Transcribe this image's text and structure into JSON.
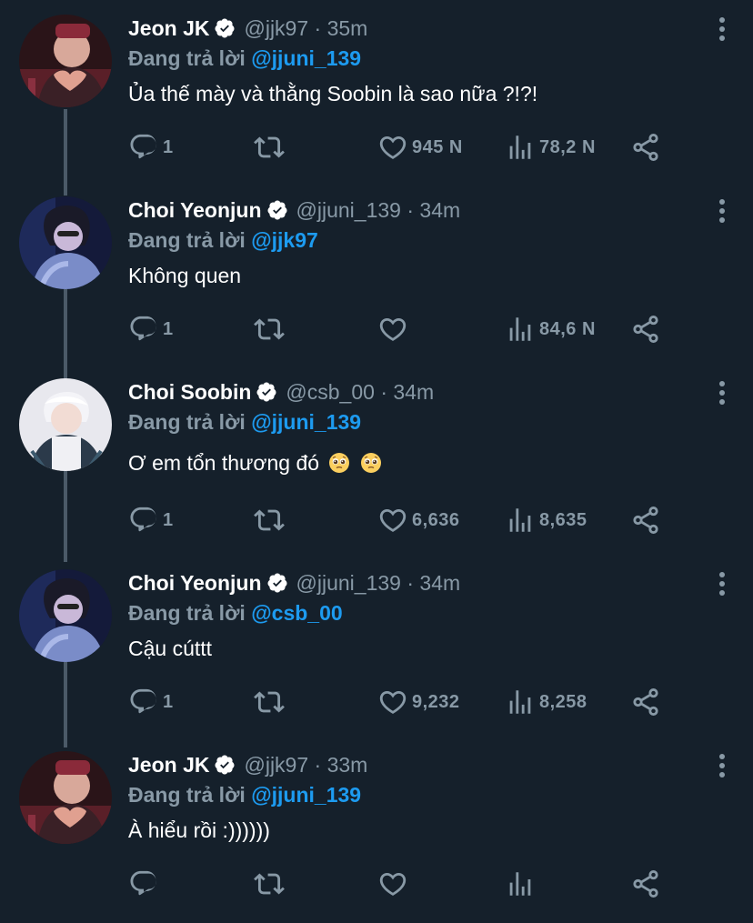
{
  "thread": {
    "line_color": "#4b5a68",
    "reply_prefix": "Đang trả lời",
    "tweets": [
      {
        "name": "Jeon JK",
        "handle_time": "@jjk97 · 35m",
        "reply_to": "@jjuni_139",
        "text": "Ủa thế mày và thằng Soobin là sao nữa ?!?!",
        "replies": "1",
        "likes": "945 N",
        "views": "78,2 N"
      },
      {
        "name": "Choi Yeonjun",
        "handle_time": "@jjuni_139 · 34m",
        "reply_to": "@jjk97",
        "text": "Không quen",
        "replies": "1",
        "likes": "",
        "views": "84,6 N"
      },
      {
        "name": "Choi Soobin",
        "handle_time": "@csb_00 · 34m",
        "reply_to": "@jjuni_139",
        "text": "Ơ em tổn thương đó",
        "emoji": "pleading-face-emoji",
        "replies": "1",
        "likes": "6,636",
        "views": "8,635"
      },
      {
        "name": "Choi Yeonjun",
        "handle_time": "@jjuni_139 · 34m",
        "reply_to": "@csb_00",
        "text": "Cậu cúttt",
        "replies": "1",
        "likes": "9,232",
        "views": "8,258"
      },
      {
        "name": "Jeon JK",
        "handle_time": "@jjk97 · 33m",
        "reply_to": "@jjuni_139",
        "text": "À hiểu rồi :))))))",
        "replies": "",
        "likes": "",
        "views": ""
      }
    ]
  },
  "colors": {
    "background": "#15202b",
    "muted": "#8899a6",
    "mention": "#1d9bf0",
    "text": "#ffffff"
  },
  "icons": [
    "verified-badge-icon",
    "reply-icon",
    "retweet-icon",
    "like-icon",
    "views-icon",
    "share-icon",
    "more-options-icon"
  ]
}
